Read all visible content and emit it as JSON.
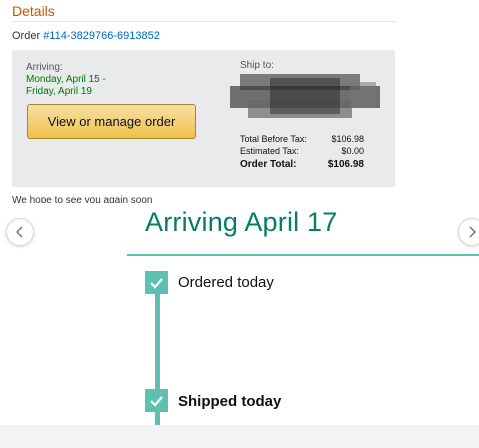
{
  "email": {
    "details_title": "Details",
    "order_prefix": "Order ",
    "order_number": "#114-3829766-6913852",
    "arriving_label": "Arriving:",
    "arriving_range": "Monday, April 15 - Friday, April 19",
    "manage_button": "View or manage order",
    "ship_to_label": "Ship to:",
    "totals": [
      {
        "label": "Total Before Tax:",
        "value": "$106.98"
      },
      {
        "label": "Estimated Tax:",
        "value": "$0.00"
      }
    ],
    "order_total_label": "Order Total:",
    "order_total_value": "$106.98",
    "cut_text": "We hope to see you again soon"
  },
  "tracking": {
    "heading": "Arriving April 17",
    "steps": [
      {
        "label": "Ordered today"
      },
      {
        "label": "Shipped today"
      }
    ]
  },
  "colors": {
    "accent_teal": "#5fbfb0",
    "heading_green": "#067d62",
    "arriving_green": "#007600",
    "details_orange": "#c45500",
    "link_blue": "#0066c0"
  },
  "icons": {
    "left": "chevron-left-icon",
    "right": "chevron-right-icon",
    "check": "checkmark-icon"
  }
}
